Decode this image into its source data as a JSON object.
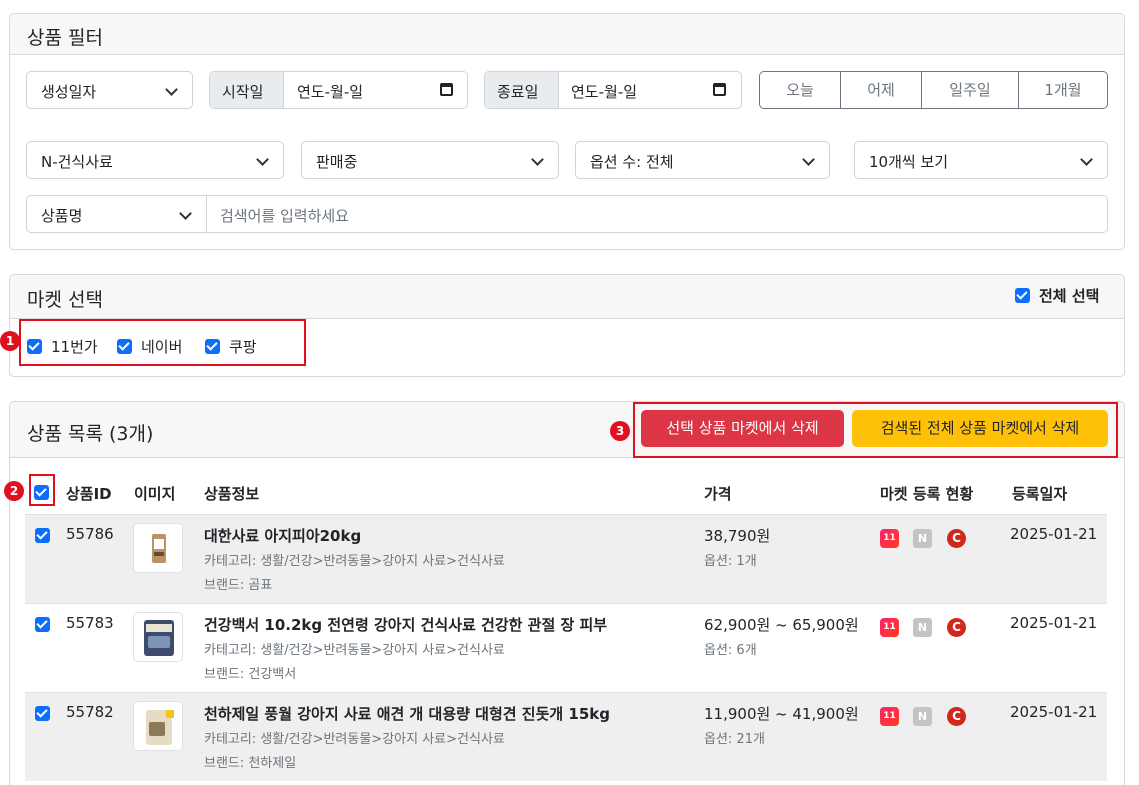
{
  "filter": {
    "title": "상품 필터",
    "date_type": "생성일자",
    "start_label": "시작일",
    "start_value": "연도-월-일",
    "end_label": "종료일",
    "end_value": "연도-월-일",
    "quick_ranges": [
      "오늘",
      "어제",
      "일주일",
      "1개월"
    ],
    "category": "N-건식사료",
    "status": "판매중",
    "option_count": "옵션 수: 전체",
    "page_size": "10개씩 보기",
    "search_field": "상품명",
    "search_placeholder": "검색어를 입력하세요"
  },
  "market": {
    "title": "마켓 선택",
    "select_all": "전체 선택",
    "items": [
      "11번가",
      "네이버",
      "쿠팡"
    ]
  },
  "products": {
    "title": "상품 목록 (3개)",
    "delete_selected": "선택 상품 마켓에서 삭제",
    "delete_all": "검색된 전체 상품 마켓에서 삭제",
    "columns": [
      "상품ID",
      "이미지",
      "상품정보",
      "가격",
      "마켓 등록 현황",
      "등록일자"
    ],
    "rows": [
      {
        "id": "55786",
        "name": "대한사료 아지피아20kg",
        "category": "카테고리: 생활/건강>반려동물>강아지 사료>건식사료",
        "brand": "브랜드: 곰표",
        "price": "38,790원",
        "options": "옵션: 1개",
        "date": "2025-01-21"
      },
      {
        "id": "55783",
        "name": "건강백서 10.2kg 전연령 강아지 건식사료 건강한 관절 장 피부",
        "category": "카테고리: 생활/건강>반려동물>강아지 사료>건식사료",
        "brand": "브랜드: 건강백서",
        "price": "62,900원 ~ 65,900원",
        "options": "옵션: 6개",
        "date": "2025-01-21"
      },
      {
        "id": "55782",
        "name": "천하제일 풍월 강아지 사료 애견 개 대용량 대형견 진돗개 15kg",
        "category": "카테고리: 생활/건강>반려동물>강아지 사료>건식사료",
        "brand": "브랜드: 천하제일",
        "price": "11,900원 ~ 41,900원",
        "options": "옵션: 21개",
        "date": "2025-01-21"
      }
    ],
    "market_icons": {
      "11st": "11",
      "naver": "N",
      "coupang": "C"
    }
  },
  "annotations": [
    "1",
    "2",
    "3"
  ],
  "colors": {
    "danger": "#dc3545",
    "warning": "#ffc107",
    "primary": "#0d6efd",
    "highlight": "#e01020"
  }
}
